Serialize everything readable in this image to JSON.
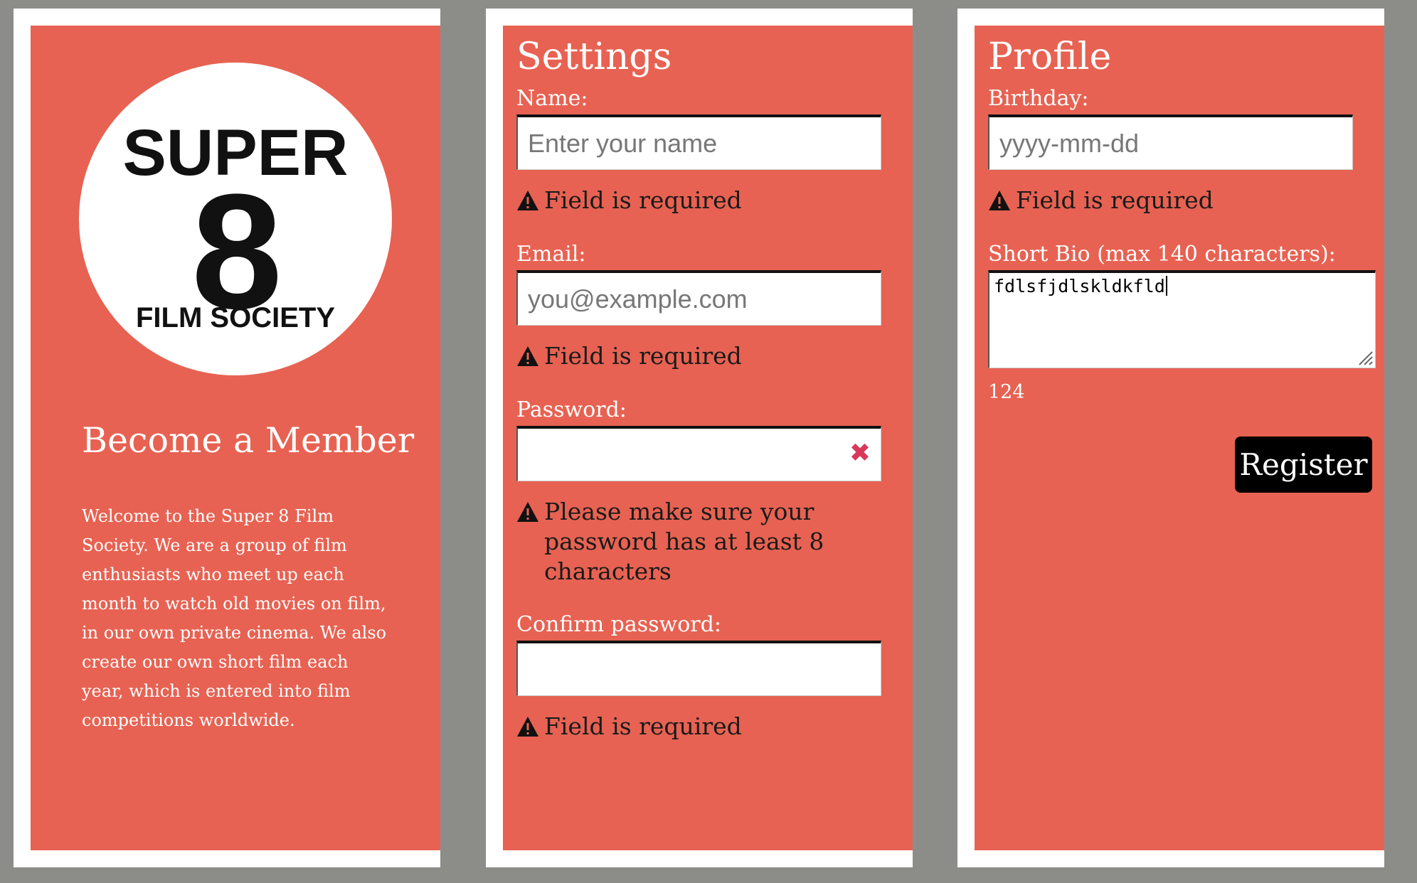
{
  "intro": {
    "logo": {
      "text_super": "SUPER",
      "text_eight": "8",
      "text_society": "FILM SOCIETY"
    },
    "title": "Become a Member",
    "description": "Welcome to the Super 8 Film Society. We are a group of film enthusiasts who meet up each month to watch old movies on film, in our own private cinema. We also create our own short film each year, which is entered into film competitions worldwide."
  },
  "settings": {
    "title": "Settings",
    "name": {
      "label": "Name:",
      "placeholder": "Enter your name",
      "value": "",
      "error": "Field is required"
    },
    "email": {
      "label": "Email:",
      "placeholder": "you@example.com",
      "value": "",
      "error": "Field is required"
    },
    "password": {
      "label": "Password:",
      "value": "",
      "clear_icon": "✖",
      "error": "Please make sure your password has at least 8 characters"
    },
    "confirm_password": {
      "label": "Confirm password:",
      "value": "",
      "error": "Field is required"
    }
  },
  "profile": {
    "title": "Profile",
    "birthday": {
      "label": "Birthday:",
      "placeholder": "yyyy-mm-dd",
      "error": "Field is required"
    },
    "bio": {
      "label": "Short Bio (max 140 characters):",
      "value": "fdlsfjdlskldkfld",
      "remaining": "124"
    },
    "register_label": "Register"
  },
  "colors": {
    "panel": "#e76252",
    "background": "#8c8d89",
    "button": "#000000",
    "clear_icon": "#d8395b"
  }
}
